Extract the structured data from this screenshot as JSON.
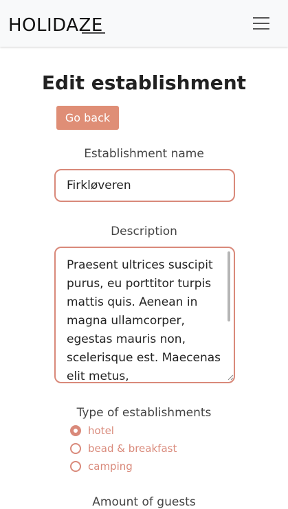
{
  "nav": {
    "brand": "HOLIDAZE",
    "menu_icon": "hamburger-menu-icon"
  },
  "page": {
    "title": "Edit establishment",
    "back_label": "Go back"
  },
  "form": {
    "name_label": "Establishment name",
    "name_value": "Firkløveren",
    "description_label": "Description",
    "description_value": "Praesent ultrices suscipit purus, eu porttitor turpis mattis quis. Aenean in magna ullamcorper, egestas mauris non, scelerisque est. Maecenas elit metus,",
    "type_label": "Type of establishments",
    "type_options": [
      {
        "label": "hotel",
        "checked": true
      },
      {
        "label": "bead & breakfast",
        "checked": false
      },
      {
        "label": "camping",
        "checked": false
      }
    ],
    "guests_label": "Amount of guests"
  },
  "colors": {
    "accent": "#d9897a",
    "button": "#df8e76",
    "navbar_bg": "#f8f9fa"
  }
}
